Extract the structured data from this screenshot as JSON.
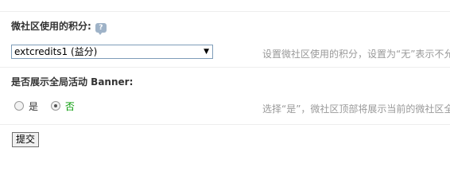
{
  "credits_setting": {
    "label": "微社区使用的积分:",
    "help_icon_glyph": "?",
    "selected_option": "extcredits1 (益分)",
    "dropdown_arrow": "▼",
    "tip": "设置微社区使用的积分，设置为“无”表示不允"
  },
  "banner_setting": {
    "label": "是否展示全局活动 Banner:",
    "options": [
      {
        "label": "是",
        "checked": false
      },
      {
        "label": "否",
        "checked": true
      }
    ],
    "tip": "选择“是”，微社区顶部将展示当前的微社区全"
  },
  "form": {
    "submit_label": "提交"
  },
  "colors": {
    "selected_option_text": "#009900",
    "tip_text": "#999999",
    "help_icon": "#9fb3c8"
  }
}
